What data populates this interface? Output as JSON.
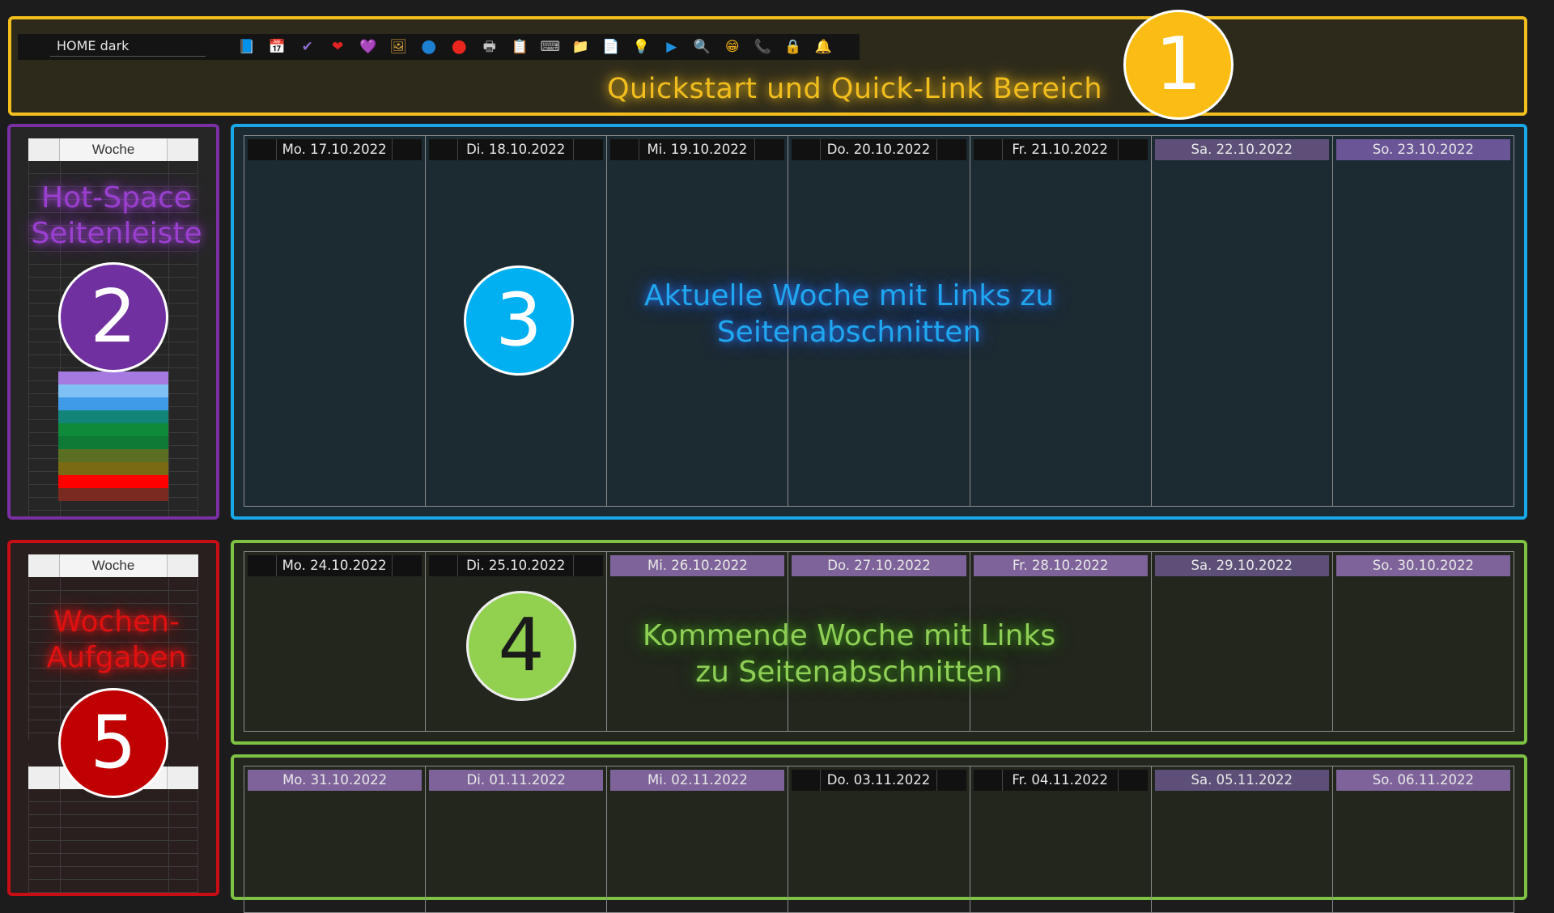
{
  "quickstart": {
    "notebook_name": "HOME dark",
    "caption": "Quickstart und Quick-Link Bereich",
    "badge": "1",
    "icons": [
      {
        "name": "book-icon",
        "glyph": "📘"
      },
      {
        "name": "calendar-icon",
        "glyph": "📅"
      },
      {
        "name": "check-icon",
        "glyph": "✔"
      },
      {
        "name": "heart-red-icon",
        "glyph": "❤"
      },
      {
        "name": "heart-purple-icon",
        "glyph": "💜"
      },
      {
        "name": "picture-icon",
        "glyph": "🖼"
      },
      {
        "name": "blue-circle-icon",
        "glyph": "●"
      },
      {
        "name": "red-circle-icon",
        "glyph": "●"
      },
      {
        "name": "printer-icon",
        "glyph": "🖶"
      },
      {
        "name": "document-list-icon",
        "glyph": "📋"
      },
      {
        "name": "keyboard-icon",
        "glyph": "⌨"
      },
      {
        "name": "folder-icon",
        "glyph": "📁"
      },
      {
        "name": "page-icon",
        "glyph": "📄"
      },
      {
        "name": "lightbulb-icon",
        "glyph": "💡"
      },
      {
        "name": "play-icon",
        "glyph": "▶"
      },
      {
        "name": "magnifier-icon",
        "glyph": "🔍"
      },
      {
        "name": "smiley-icon",
        "glyph": "😁"
      },
      {
        "name": "phone-icon",
        "glyph": "📞"
      },
      {
        "name": "lock-icon",
        "glyph": "🔒"
      },
      {
        "name": "bell-icon",
        "glyph": "🔔"
      }
    ],
    "icon_colors": [
      "#2f8fe0",
      "#cfd6de",
      "#8b6bd0",
      "#e02222",
      "#9a4fd6",
      "#d9a63a",
      "#1e7fd0",
      "#e8261e",
      "#c8c8c8",
      "#d8d8d8",
      "#bfbfbf",
      "#f2bf2b",
      "#e8e8e8",
      "#f2c21a",
      "#1e90e0",
      "#2a7fd0",
      "#f2b01a",
      "#e33",
      "#f2b81a",
      "#f2c21a"
    ]
  },
  "hotspace": {
    "header": "Woche",
    "label_line1": "Hot-Space",
    "label_line2": "Seitenleiste",
    "badge": "2",
    "stripe_colors": [
      "#a57ae0",
      "#7fc0f5",
      "#3f9ae8",
      "#138478",
      "#0e8a3a",
      "#0f7a35",
      "#5b6f24",
      "#7b6a14",
      "#ff0000",
      "#7a2a20"
    ]
  },
  "tasks": {
    "header": "Woche",
    "label_line1": "Wochen-",
    "label_line2": "Aufgaben",
    "badge": "5"
  },
  "current_week": {
    "caption_line1": "Aktuelle Woche mit Links zu",
    "caption_line2": "Seitenabschnitten",
    "badge": "3",
    "days": [
      {
        "label": "Mo. 17.10.2022",
        "style": "work"
      },
      {
        "label": "Di. 18.10.2022",
        "style": "work"
      },
      {
        "label": "Mi. 19.10.2022",
        "style": "work"
      },
      {
        "label": "Do. 20.10.2022",
        "style": "work"
      },
      {
        "label": "Fr. 21.10.2022",
        "style": "work"
      },
      {
        "label": "Sa. 22.10.2022",
        "style": "wke"
      },
      {
        "label": "So. 23.10.2022",
        "style": "wk"
      }
    ]
  },
  "next_week": {
    "caption_line1": "Kommende Woche mit Links",
    "caption_line2": "zu Seitenabschnitten",
    "badge": "4",
    "days": [
      {
        "label": "Mo. 24.10.2022",
        "style": "work"
      },
      {
        "label": "Di. 25.10.2022",
        "style": "work"
      },
      {
        "label": "Mi. 26.10.2022",
        "style": "hl"
      },
      {
        "label": "Do. 27.10.2022",
        "style": "hl"
      },
      {
        "label": "Fr. 28.10.2022",
        "style": "hl"
      },
      {
        "label": "Sa. 29.10.2022",
        "style": "wke"
      },
      {
        "label": "So. 30.10.2022",
        "style": "hl"
      }
    ]
  },
  "week_after": {
    "days": [
      {
        "label": "Mo. 31.10.2022",
        "style": "hl"
      },
      {
        "label": "Di. 01.11.2022",
        "style": "hl"
      },
      {
        "label": "Mi. 02.11.2022",
        "style": "hl"
      },
      {
        "label": "Do. 03.11.2022",
        "style": "work"
      },
      {
        "label": "Fr. 04.11.2022",
        "style": "work"
      },
      {
        "label": "Sa. 05.11.2022",
        "style": "wke"
      },
      {
        "label": "So. 06.11.2022",
        "style": "hl"
      }
    ]
  },
  "colors": {
    "quickstart_border": "#f2be1d",
    "hotspace_border": "#7a2fa2",
    "tasks_border": "#c70e14",
    "current_week_border": "#18a8e8",
    "next_week_border": "#7dc242",
    "badge1": "#fbbd14",
    "badge2": "#7030a0",
    "badge3": "#00b0f0",
    "badge4": "#92d050",
    "badge5": "#c00000"
  }
}
